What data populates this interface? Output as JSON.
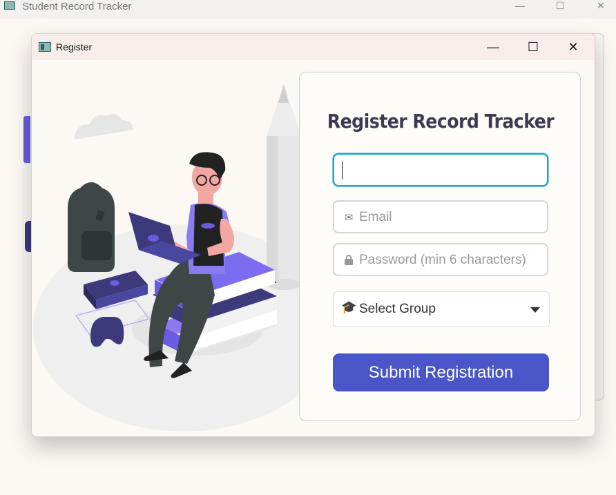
{
  "parent_window": {
    "title": "Student Record Tracker",
    "controls": {
      "minimize": "—",
      "maximize": "☐",
      "close": "✕"
    }
  },
  "dialog": {
    "title": "Register",
    "controls": {
      "minimize": "—",
      "maximize": "☐",
      "close": "✕"
    }
  },
  "illustration": {
    "description_icon": "student-with-laptop-on-books-illustration",
    "colors": {
      "accent": "#6a5ce0",
      "dark": "#3c3a7a",
      "backpack": "#3f4746"
    }
  },
  "form": {
    "title": "Register Record Tracker",
    "name_field": {
      "value": "",
      "placeholder": ""
    },
    "email_field": {
      "value": "",
      "placeholder": "Email",
      "icon": "mail-icon"
    },
    "password_field": {
      "value": "",
      "placeholder": "Password (min 6 characters)",
      "icon": "lock-icon"
    },
    "group_select": {
      "selected": "Select Group",
      "icon": "graduation-cap-icon"
    },
    "submit_label": "Submit Registration",
    "colors": {
      "focus": "#1aa3c6",
      "submit_bg": "#4a55c7",
      "title": "#3d3b52"
    }
  }
}
